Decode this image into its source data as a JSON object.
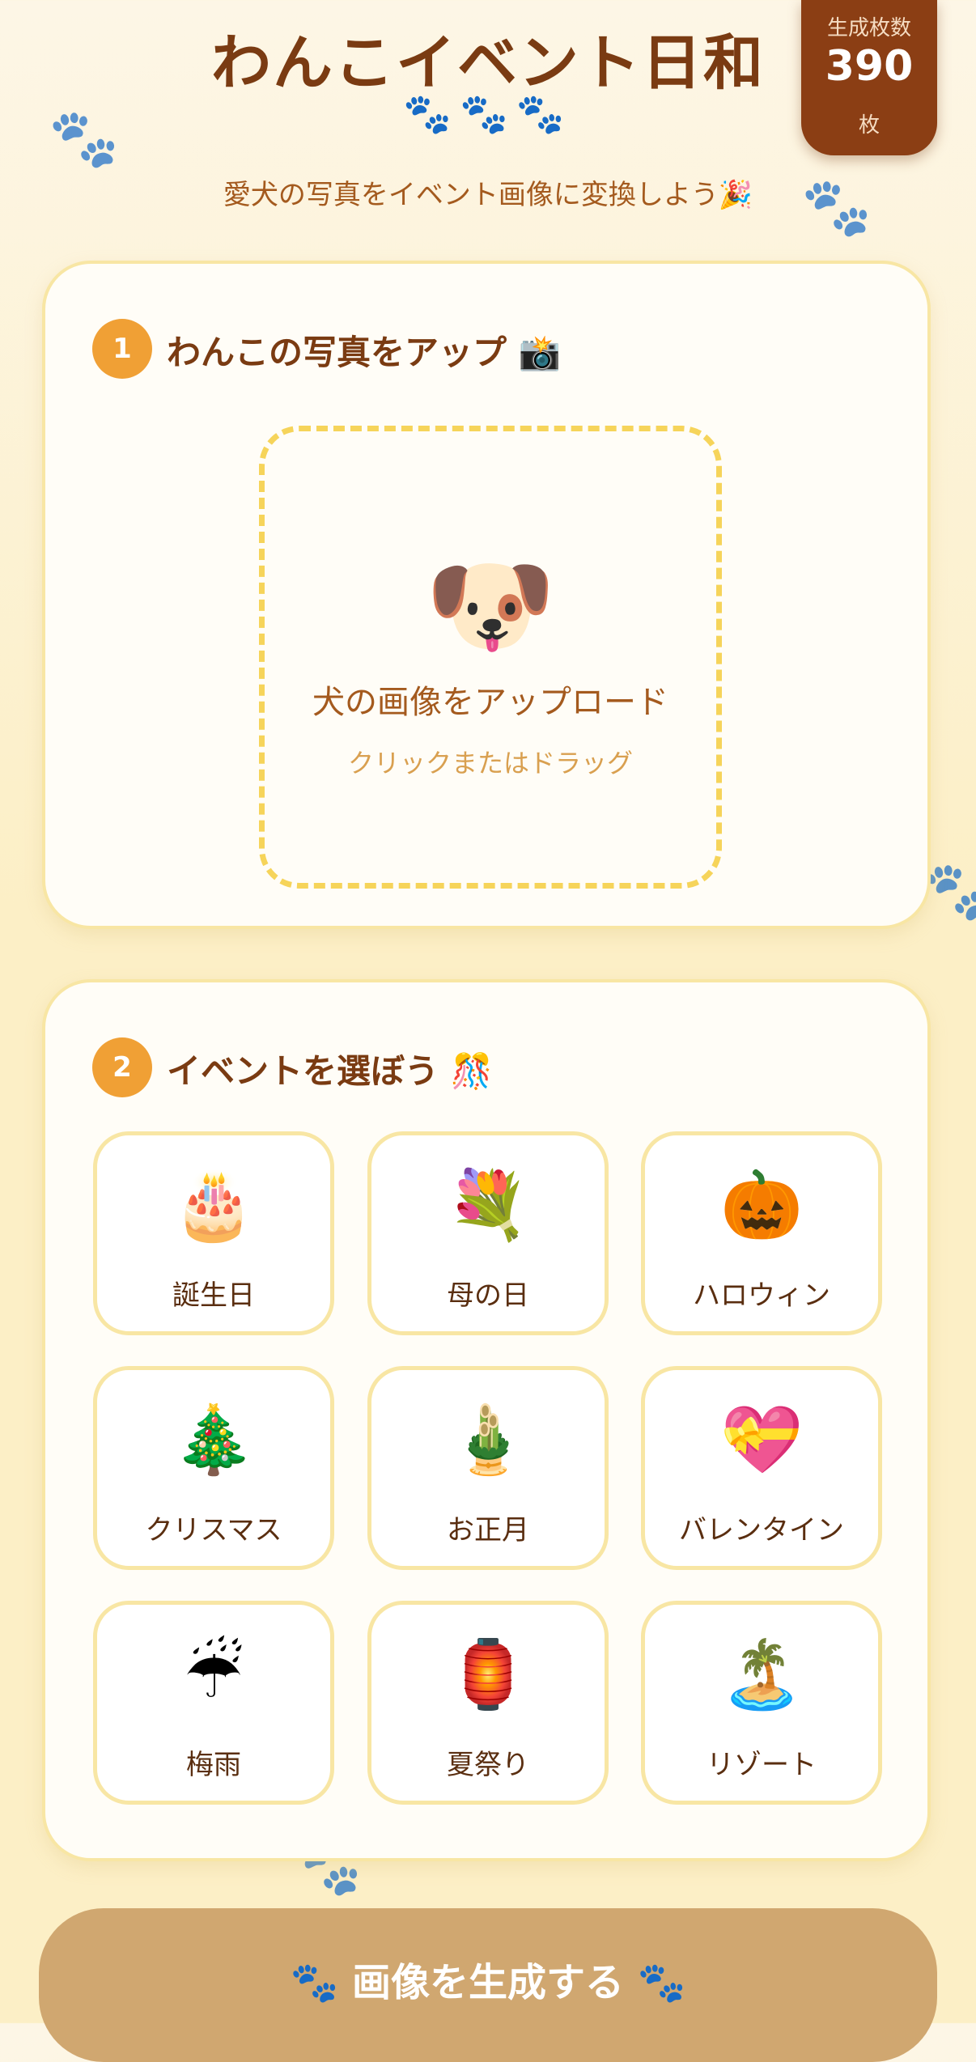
{
  "header": {
    "title": "わんこイベント日和",
    "paws": "🐾🐾🐾",
    "subtitle": "愛犬の写真をイベント画像に変換しよう🎉"
  },
  "counter": {
    "label": "生成枚数",
    "value": "390",
    "unit": "枚"
  },
  "step1": {
    "number": "1",
    "title": "わんこの写真をアップ 📸",
    "upload_icon": "🐶",
    "upload_main": "犬の画像をアップロード",
    "upload_sub": "クリックまたはドラッグ"
  },
  "step2": {
    "number": "2",
    "title": "イベントを選ぼう 🎊",
    "events": [
      {
        "icon": "🎂",
        "label": "誕生日"
      },
      {
        "icon": "💐",
        "label": "母の日"
      },
      {
        "icon": "🎃",
        "label": "ハロウィン"
      },
      {
        "icon": "🎄",
        "label": "クリスマス"
      },
      {
        "icon": "🎍",
        "label": "お正月"
      },
      {
        "icon": "💝",
        "label": "バレンタイン"
      },
      {
        "icon": "☔",
        "label": "梅雨"
      },
      {
        "icon": "🏮",
        "label": "夏祭り"
      },
      {
        "icon": "🏝️",
        "label": "リゾート"
      }
    ]
  },
  "generate_button": {
    "label": "🐾 画像を生成する 🐾"
  },
  "colors": {
    "primary_text": "#7A3B12",
    "accent": "#F0A035",
    "counter_bg": "#8B3E14",
    "card_border": "#F8E6A4",
    "dashed_border": "#F6D45A",
    "generate_button_bg": "#D0A770"
  }
}
